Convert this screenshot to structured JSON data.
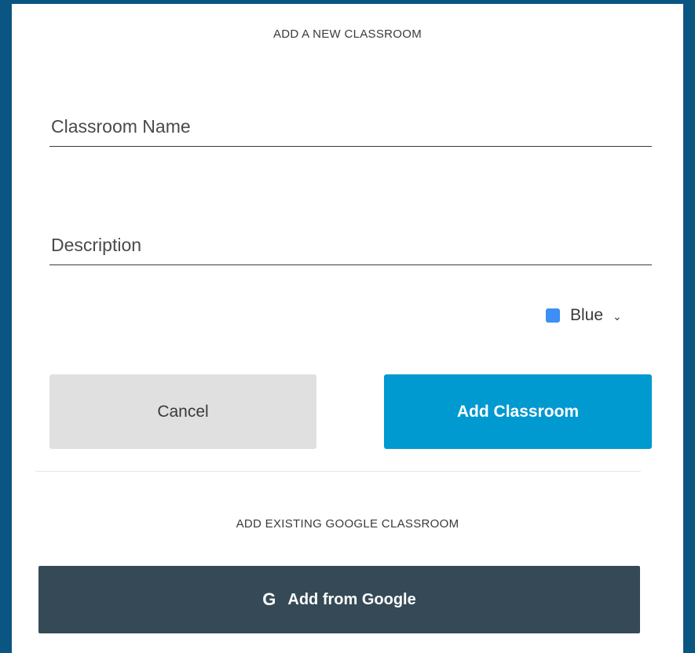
{
  "modal": {
    "title": "ADD A NEW CLASSROOM",
    "name_placeholder": "Classroom Name",
    "description_placeholder": "Description",
    "color": {
      "label": "Blue",
      "swatch_color": "#3d8ef5",
      "dropdown_icon": "chevron-down-icon"
    },
    "cancel_label": "Cancel",
    "add_label": "Add Classroom",
    "google_section_title": "ADD EXISTING GOOGLE CLASSROOM",
    "google_icon": "google-g-icon",
    "google_button_label": "Add from Google"
  },
  "colors": {
    "background": "#0b5583",
    "primary": "#0099d0",
    "cancel": "#e0e0e0",
    "google_button": "#354a56"
  }
}
